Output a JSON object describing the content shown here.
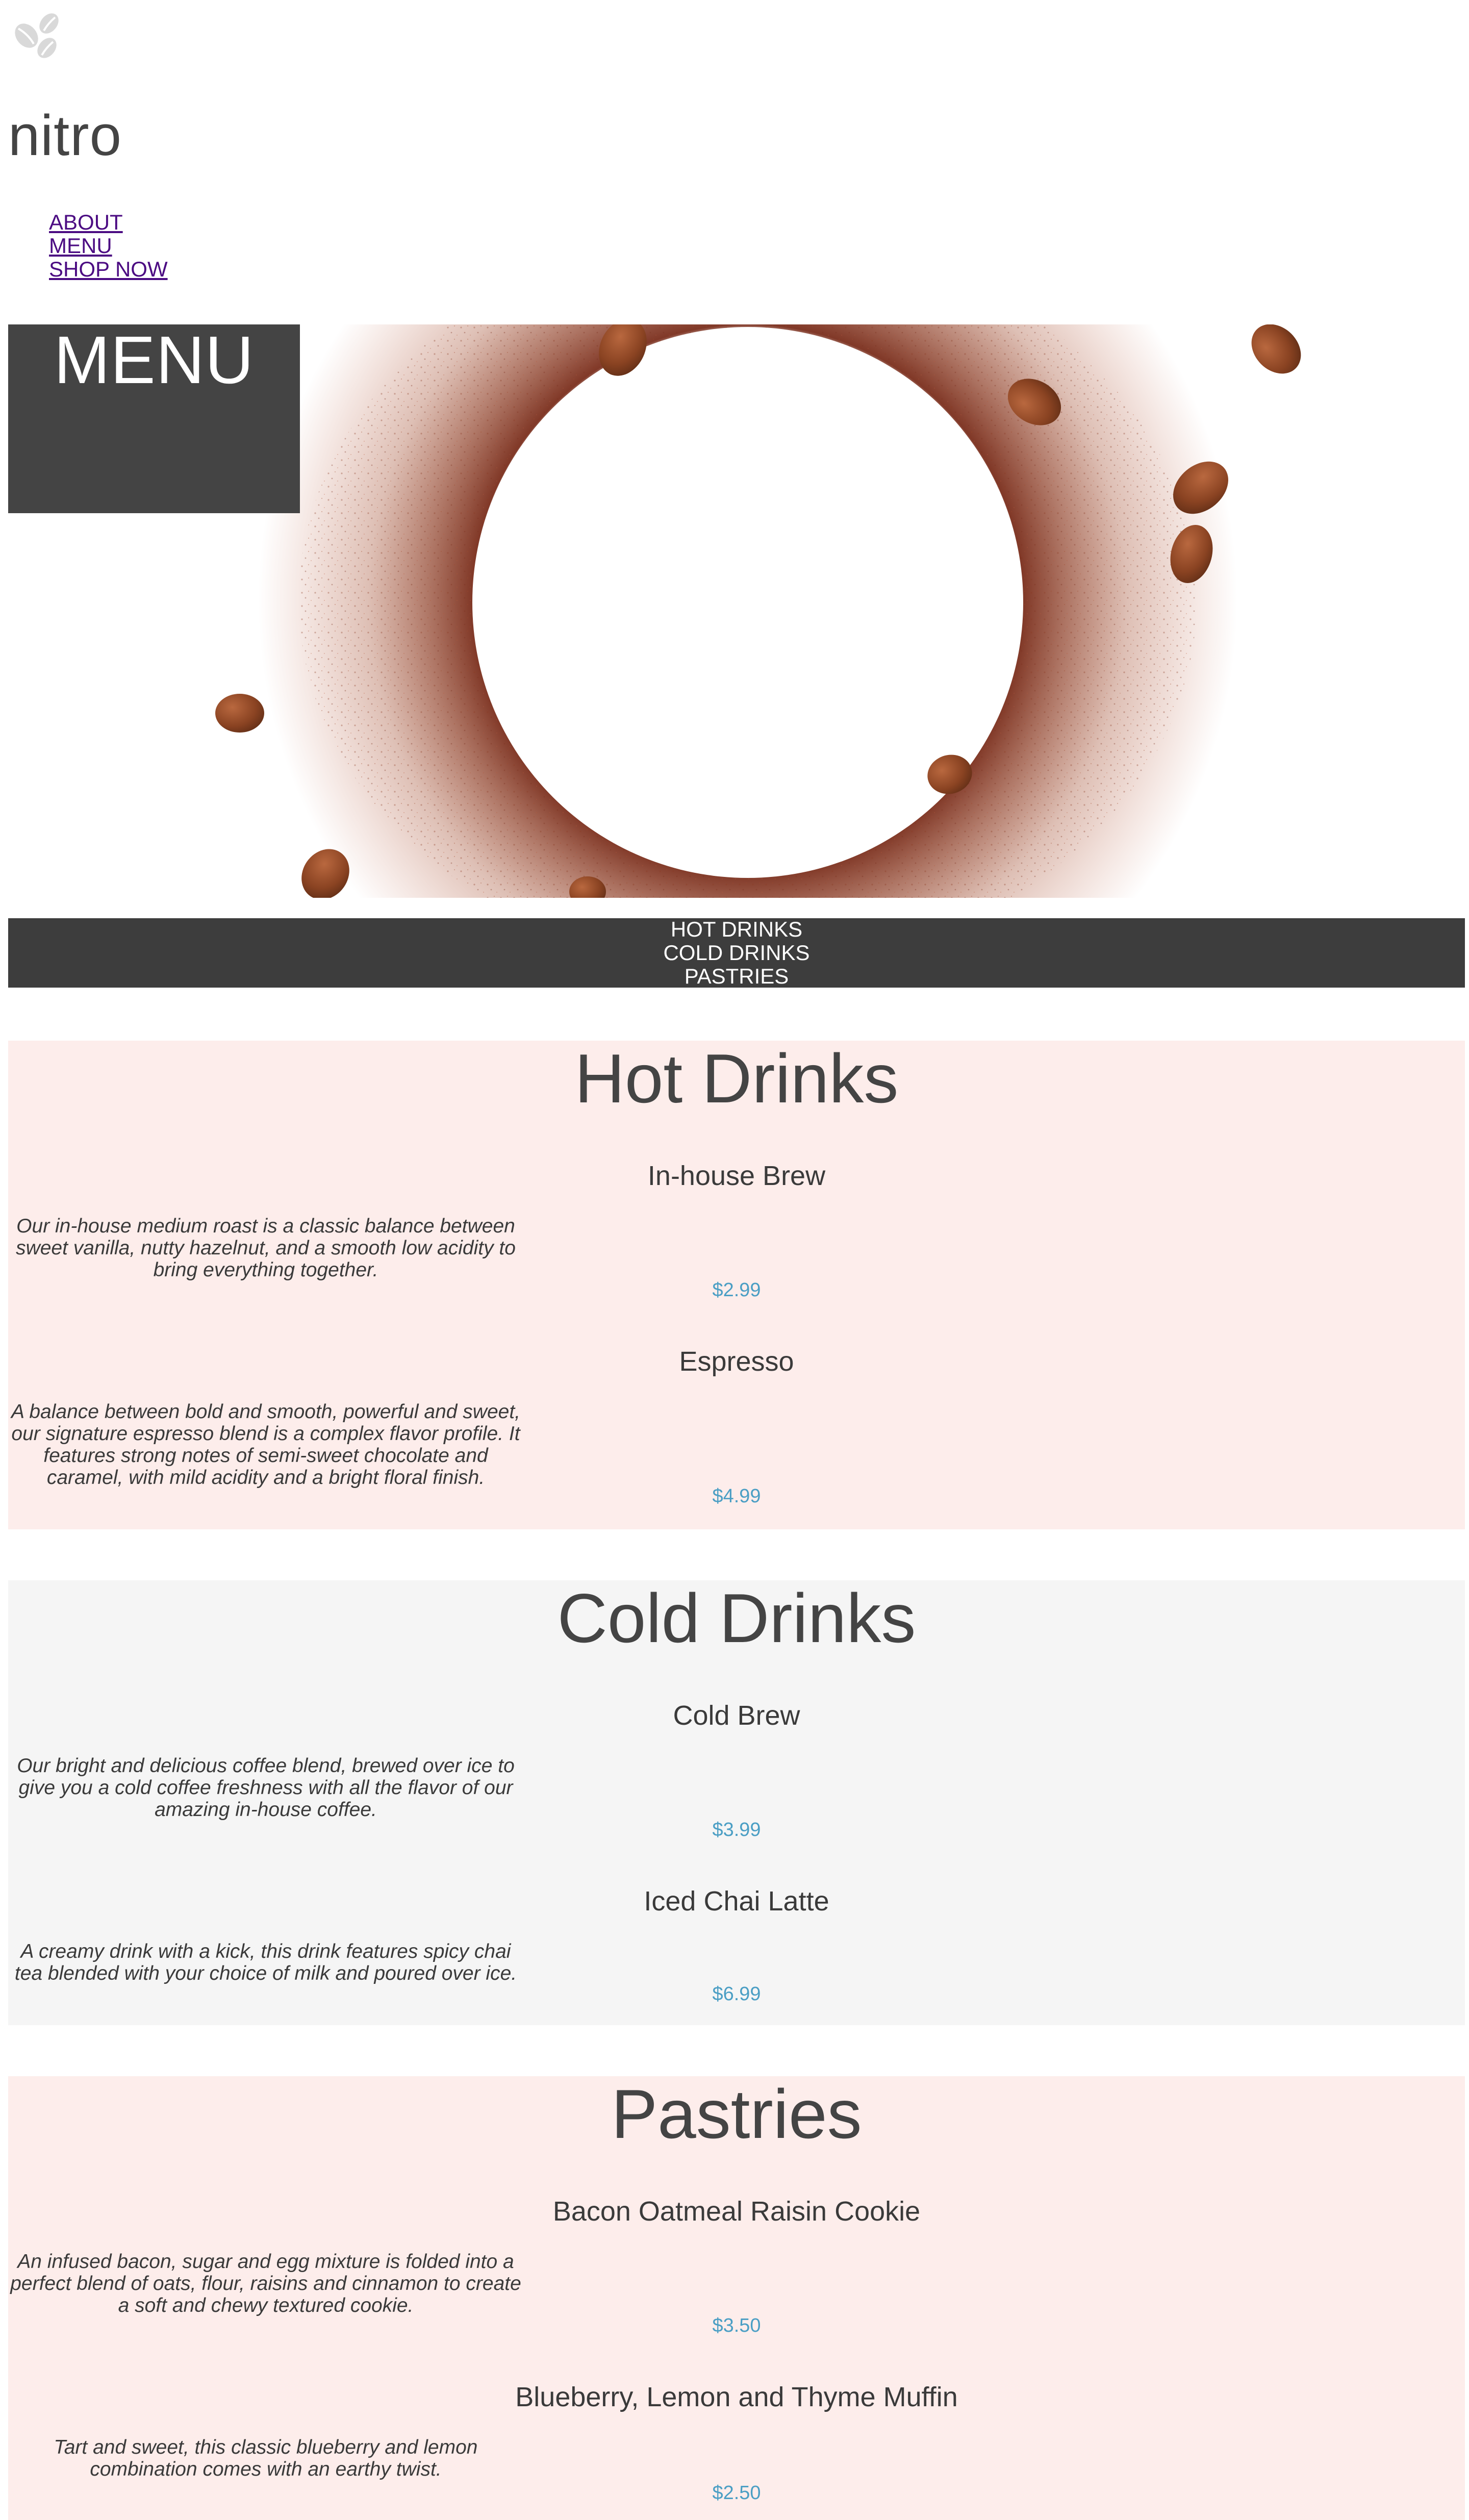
{
  "brand": {
    "name": "nitro",
    "logo_icon": "coffee-beans-icon"
  },
  "nav": {
    "items": [
      "ABOUT",
      "MENU",
      "SHOP NOW"
    ]
  },
  "hero": {
    "label": "MENU",
    "image": "coffee-grounds-ring-with-beans"
  },
  "categories": [
    "HOT DRINKS",
    "COLD DRINKS",
    "PASTRIES"
  ],
  "colors": {
    "dark_box": "#444444",
    "category_bar": "#3d3d3d",
    "pink_bg": "#fdedeb",
    "gray_bg": "#f5f5f5",
    "price": "#4a9ec4",
    "nav_link": "#4b0b82"
  },
  "sections": [
    {
      "title": "Hot Drinks",
      "items": [
        {
          "name": "In-house Brew",
          "description": "Our in-house medium roast is a classic balance between sweet vanilla, nutty hazelnut, and a smooth low acidity to bring everything together.",
          "price": "$2.99"
        },
        {
          "name": "Espresso",
          "description": "A balance between bold and smooth, powerful and sweet, our signature espresso blend is a complex flavor profile. It features strong notes of semi-sweet chocolate and caramel, with mild acidity and a bright floral finish.",
          "price": "$4.99"
        }
      ]
    },
    {
      "title": "Cold Drinks",
      "items": [
        {
          "name": "Cold Brew",
          "description": "Our bright and delicious coffee blend, brewed over ice to give you a cold coffee freshness with all the flavor of our amazing in-house coffee.",
          "price": "$3.99"
        },
        {
          "name": "Iced Chai Latte",
          "description": "A creamy drink with a kick, this drink features spicy chai tea blended with your choice of milk and poured over ice.",
          "price": "$6.99"
        }
      ]
    },
    {
      "title": "Pastries",
      "items": [
        {
          "name": "Bacon Oatmeal Raisin Cookie",
          "description": "An infused bacon, sugar and egg mixture is folded into a perfect blend of oats, flour, raisins and cinnamon to create a soft and chewy textured cookie.",
          "price": "$3.50"
        },
        {
          "name": "Blueberry, Lemon and Thyme Muffin",
          "description": "Tart and sweet, this classic blueberry and lemon combination comes with an earthy twist.",
          "price": "$2.50"
        }
      ]
    }
  ]
}
